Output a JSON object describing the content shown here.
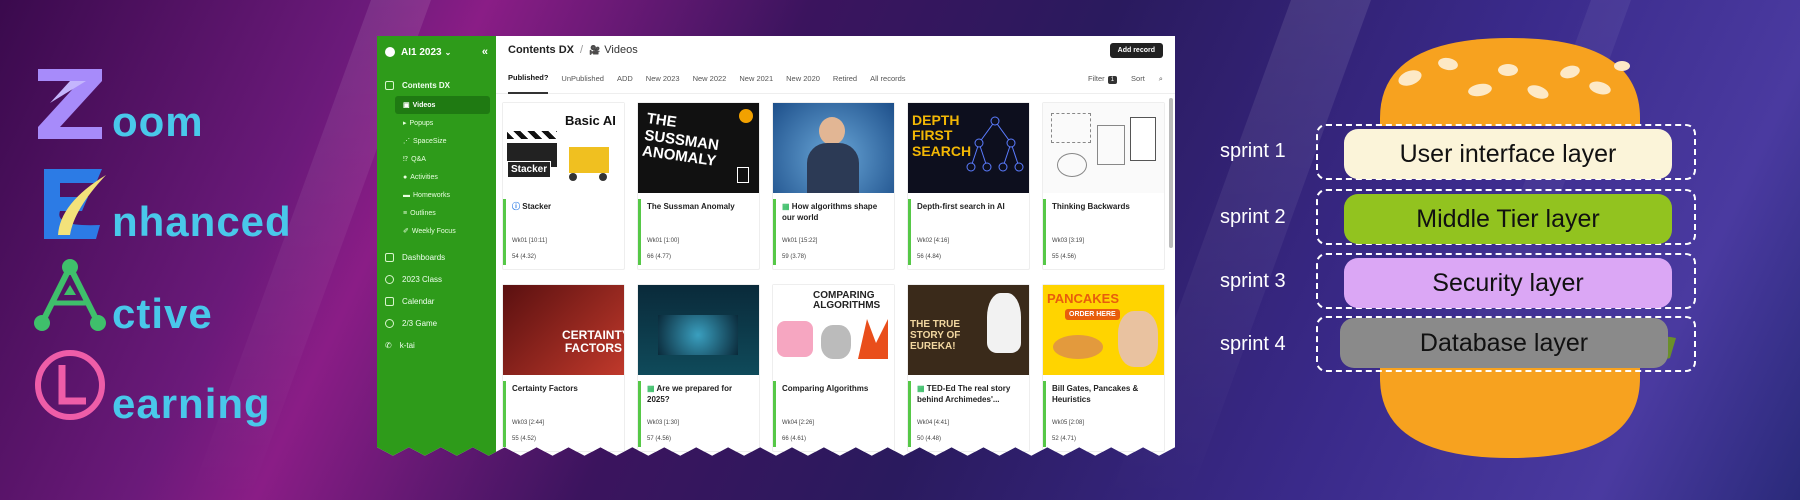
{
  "logo": {
    "rows": [
      {
        "letter": "Z",
        "rest": "oom"
      },
      {
        "letter": "E",
        "rest": "nhanced"
      },
      {
        "letter": "A",
        "rest": "ctive"
      },
      {
        "letter": "L",
        "rest": "earning"
      }
    ],
    "colors": {
      "purple": "#a78bfa",
      "yellow": "#f3e27a",
      "green": "#3fbf6b",
      "pink": "#ee5da8",
      "cyan": "#49c8ea"
    }
  },
  "app": {
    "workspace": "AI1 2023",
    "sidebar": {
      "section": "Contents DX",
      "subitems": [
        {
          "icon": "video-icon",
          "label": "Videos"
        },
        {
          "icon": "popup-icon",
          "label": "Popups"
        },
        {
          "icon": "spacesize-icon",
          "label": "SpaceSize"
        },
        {
          "icon": "qa-icon",
          "label": "Q&A"
        },
        {
          "icon": "activities-icon",
          "label": "Activities"
        },
        {
          "icon": "homework-icon",
          "label": "Homeworks"
        },
        {
          "icon": "outline-icon",
          "label": "Outlines"
        },
        {
          "icon": "focus-icon",
          "label": "Weekly Focus"
        }
      ],
      "items": [
        {
          "icon": "dashboard-icon",
          "label": "Dashboards"
        },
        {
          "icon": "class-icon",
          "label": "2023 Class"
        },
        {
          "icon": "calendar-icon",
          "label": "Calendar"
        },
        {
          "icon": "game-icon",
          "label": "2/3 Game"
        },
        {
          "icon": "phone-icon",
          "label": "k-tai"
        }
      ]
    },
    "header": {
      "section": "Contents DX",
      "page": "Videos",
      "add_label": "Add record"
    },
    "tabs": [
      "Published?",
      "UnPublished",
      "ADD",
      "New 2023",
      "New 2022",
      "New 2021",
      "New 2020",
      "Retired",
      "All records"
    ],
    "filter_label": "Filter",
    "filter_count": "1",
    "sort_label": "Sort",
    "cards": [
      {
        "title": "Stacker",
        "thumb_text": "Basic AI",
        "thumb_sub": "Stacker",
        "meta": "Wk01 [10:11]",
        "rating": "54 (4.32)"
      },
      {
        "title": "The Sussman Anomaly",
        "thumb_text": "THE SUSSMAN ANOMALY",
        "thumb_sub": "",
        "meta": "Wk01 [1:00]",
        "rating": "66 (4.77)"
      },
      {
        "title": "How algorithms shape our world",
        "thumb_text": "",
        "thumb_sub": "",
        "meta": "Wk01 [15:22]",
        "rating": "59 (3.78)"
      },
      {
        "title": "Depth-first search in AI",
        "thumb_text": "DEPTH FIRST SEARCH",
        "thumb_sub": "",
        "meta": "Wk02 [4:16]",
        "rating": "56 (4.84)"
      },
      {
        "title": "Thinking Backwards",
        "thumb_text": "",
        "thumb_sub": "",
        "meta": "Wk03 [3:19]",
        "rating": "55 (4.56)"
      },
      {
        "title": "Certainty Factors",
        "thumb_text": "CERTAINTY FACTORS",
        "thumb_sub": "",
        "meta": "Wk03 [2:44]",
        "rating": "55 (4.52)"
      },
      {
        "title": "Are we prepared for 2025?",
        "thumb_text": "",
        "thumb_sub": "",
        "meta": "Wk03 [1:30]",
        "rating": "57 (4.56)"
      },
      {
        "title": "Comparing Algorithms",
        "thumb_text": "COMPARING ALGORITHMS",
        "thumb_sub": "",
        "meta": "Wk04 [2:26]",
        "rating": "66 (4.61)"
      },
      {
        "title": "TED-Ed The real story behind Archimedes'...",
        "thumb_text": "THE TRUE STORY OF EUREKA!",
        "thumb_sub": "",
        "meta": "Wk04 [4:41]",
        "rating": "50 (4.48)"
      },
      {
        "title": "Bill Gates, Pancakes & Heuristics",
        "thumb_text": "PANCAKES",
        "thumb_sub": "ORDER HERE",
        "meta": "Wk05 [2:08]",
        "rating": "52 (4.71)"
      }
    ]
  },
  "architecture": {
    "layers": [
      {
        "sprint": "sprint 1",
        "label": "User interface layer",
        "color": "#fbf4d9"
      },
      {
        "sprint": "sprint 2",
        "label": "Middle Tier layer",
        "color": "#92c31f"
      },
      {
        "sprint": "sprint 3",
        "label": "Security layer",
        "color": "#dba7f5"
      },
      {
        "sprint": "sprint 4",
        "label": "Database layer",
        "color": "#8a8a8a"
      }
    ],
    "bun_color": "#f7a21f",
    "lettuce_color": "#6b8f2a"
  }
}
